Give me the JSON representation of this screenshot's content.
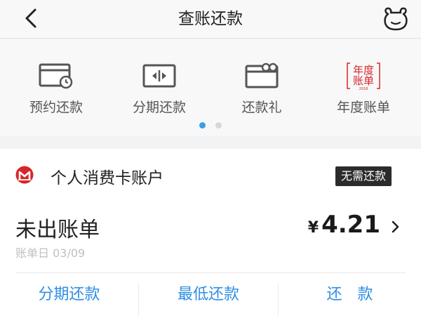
{
  "header": {
    "title": "查账还款",
    "back_icon": "chevron-left-icon",
    "avatar_icon": "frog-avatar-icon"
  },
  "quick_actions": [
    {
      "label": "预约还款",
      "icon": "card-clock-icon"
    },
    {
      "label": "分期还款",
      "icon": "card-installment-icon"
    },
    {
      "label": "还款礼",
      "icon": "card-gift-icon"
    },
    {
      "label": "年度账单",
      "icon": "annual-bill-stamp-icon",
      "stamp_text": "年度账单",
      "stamp_year": "2018"
    }
  ],
  "pager": {
    "pages": 2,
    "active": 0
  },
  "account": {
    "bank_icon": "cmb-logo-icon",
    "name": "个人消费卡账户",
    "badge": "无需还款",
    "status": "未出账单",
    "bill_date": "账单日 03/09",
    "currency": "¥",
    "amount": "4.21"
  },
  "actions": {
    "installment": "分期还款",
    "minimum": "最低还款",
    "repay": "还　款"
  },
  "colors": {
    "accent": "#2f8ee5",
    "bank_red": "#d7262b",
    "badge_bg": "#2b2b2b"
  }
}
